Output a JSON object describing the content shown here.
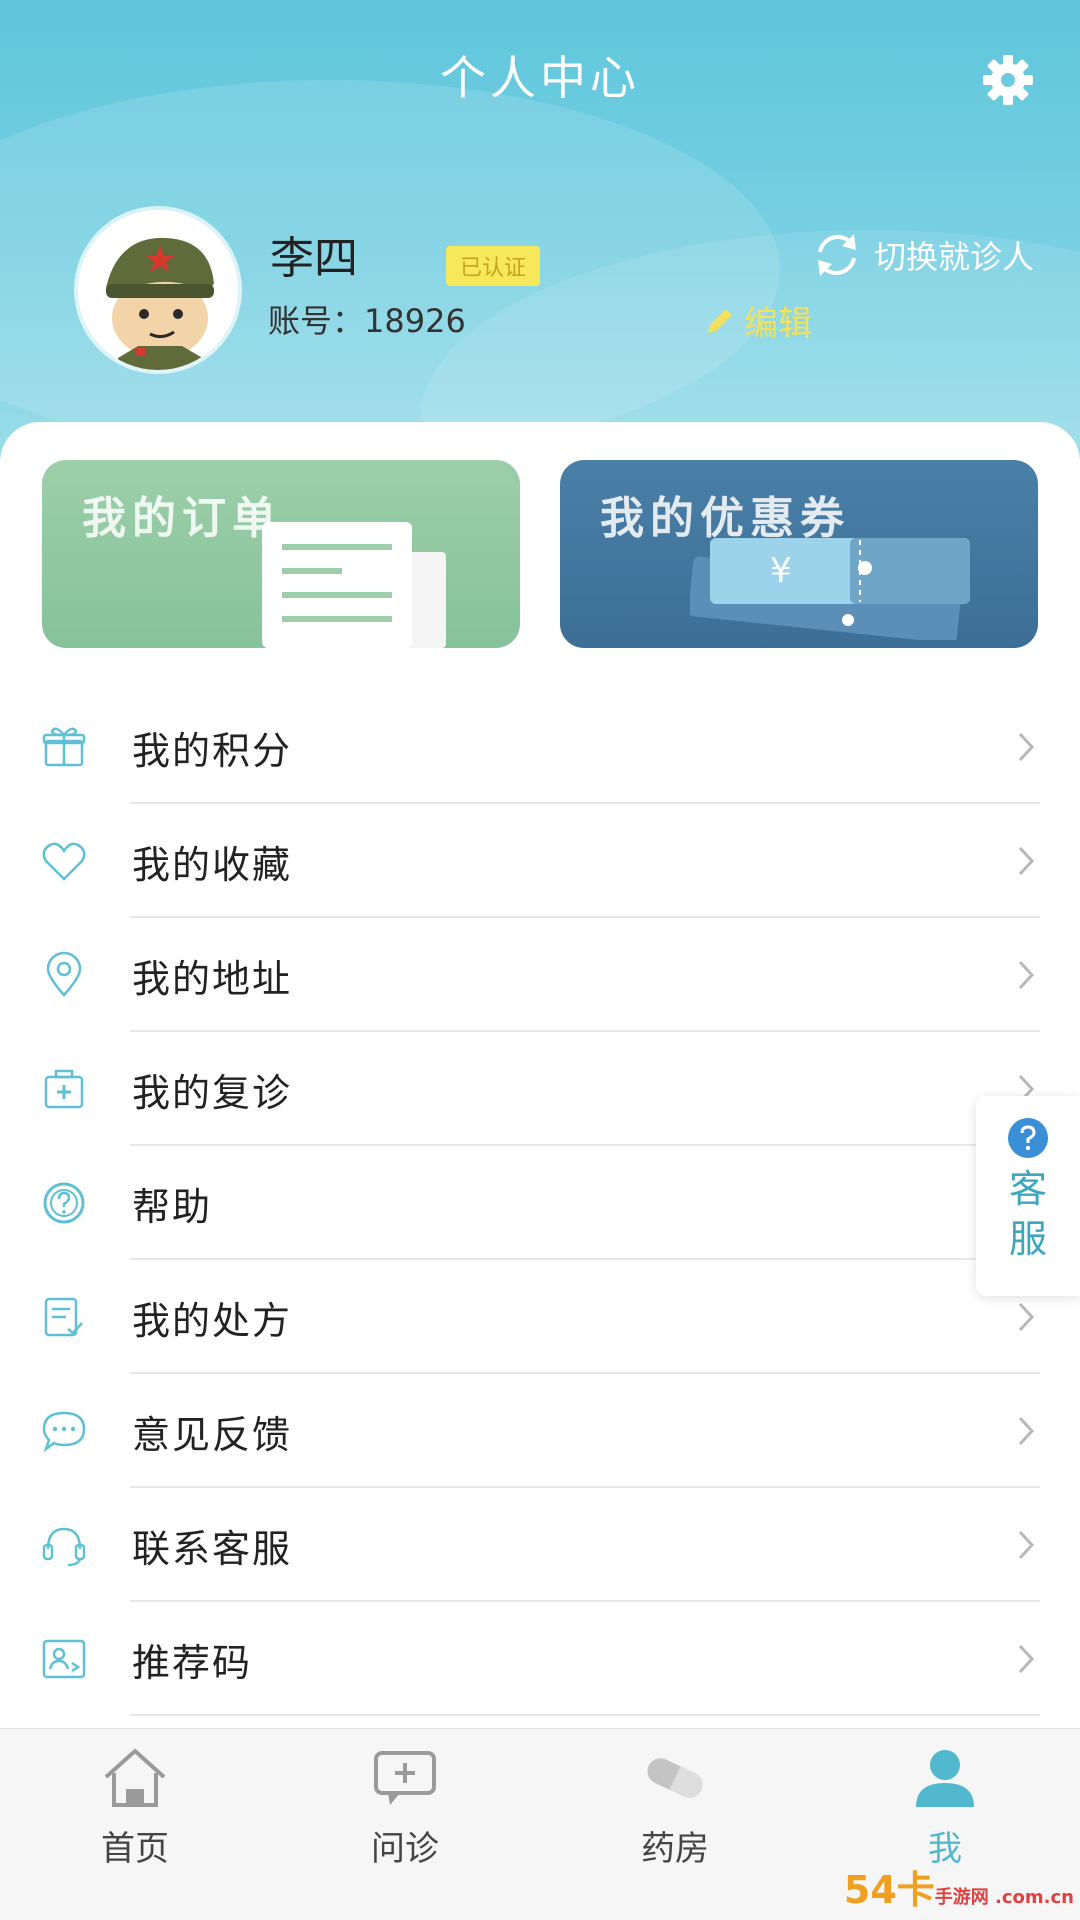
{
  "header": {
    "title": "个人中心",
    "settings_icon": "gear-icon"
  },
  "profile": {
    "name": "李四",
    "verified_badge": "已认证",
    "account_label": "账号：",
    "account_value": "18926",
    "switch_patient": "切换就诊人",
    "edit": "编辑"
  },
  "banners": {
    "orders": "我的订单",
    "coupons": "我的优惠券",
    "coupon_symbol": "¥"
  },
  "menu": [
    {
      "label": "我的积分",
      "icon": "gift-icon"
    },
    {
      "label": "我的收藏",
      "icon": "heart-icon"
    },
    {
      "label": "我的地址",
      "icon": "location-pin-icon"
    },
    {
      "label": "我的复诊",
      "icon": "medical-kit-icon"
    },
    {
      "label": "帮助",
      "icon": "question-circle-icon"
    },
    {
      "label": "我的处方",
      "icon": "prescription-icon"
    },
    {
      "label": "意见反馈",
      "icon": "chat-bubble-icon"
    },
    {
      "label": "联系客服",
      "icon": "headset-icon"
    },
    {
      "label": "推荐码",
      "icon": "referral-card-icon"
    }
  ],
  "float_service": {
    "line1": "客",
    "line2": "服"
  },
  "bottom_nav": [
    {
      "label": "首页",
      "icon": "home-icon",
      "active": false
    },
    {
      "label": "问诊",
      "icon": "consult-icon",
      "active": false
    },
    {
      "label": "药房",
      "icon": "pill-icon",
      "active": false
    },
    {
      "label": "我",
      "icon": "user-icon",
      "active": true
    }
  ],
  "watermark": {
    "main": "54卡",
    "sub": "手游网 .com.cn"
  },
  "colors": {
    "header_top": "#5fc6dc",
    "accent": "#52b8cd",
    "verified_bg": "#f6e85a",
    "edit_color": "#f3e05b"
  }
}
